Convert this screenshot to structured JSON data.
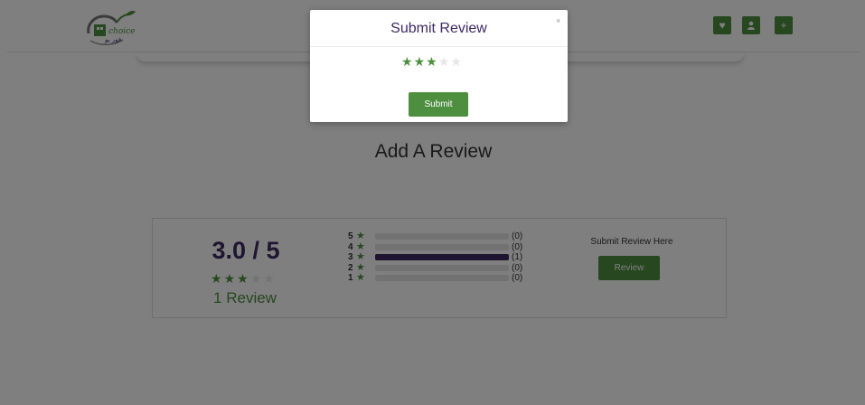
{
  "header": {
    "buttons": [
      {
        "name": "favorites-button",
        "icon": "heart-icon",
        "glyph": "♥"
      },
      {
        "name": "account-button",
        "icon": "user-icon",
        "glyph": "●"
      },
      {
        "name": "add-button",
        "icon": "plus-icon",
        "glyph": "+"
      }
    ]
  },
  "main": {
    "title": "Add A Review"
  },
  "summary": {
    "average": "3.0 / 5",
    "rating": 3,
    "max_rating": 5,
    "count_text": "1 Review",
    "breakdown": [
      {
        "stars": "5",
        "count": "(0)",
        "fraction": 0
      },
      {
        "stars": "4",
        "count": "(0)",
        "fraction": 0
      },
      {
        "stars": "3",
        "count": "(1)",
        "fraction": 1
      },
      {
        "stars": "2",
        "count": "(0)",
        "fraction": 0
      },
      {
        "stars": "1",
        "count": "(0)",
        "fraction": 0
      }
    ],
    "submit_label": "Submit Review Here",
    "review_button": "Review"
  },
  "modal": {
    "title": "Submit Review",
    "close": "×",
    "selected_rating": 3,
    "max_rating": 5,
    "submit_button": "Submit"
  },
  "colors": {
    "accent_green": "#4d8f3f",
    "accent_purple": "#3c2a63",
    "star_off": "#e6e6e6"
  }
}
